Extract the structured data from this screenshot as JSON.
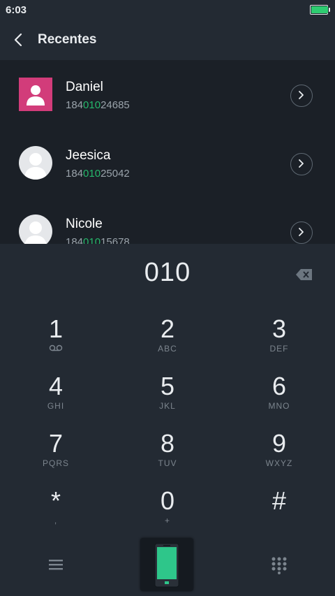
{
  "status": {
    "time": "6:03",
    "battery_level": 1.0,
    "battery_color": "#2ecc71"
  },
  "header": {
    "title": "Recentes"
  },
  "contacts": [
    {
      "name": "Daniel",
      "num_pre": "184",
      "num_match": "010",
      "num_post": "24685",
      "avatar": "photo-icon"
    },
    {
      "name": "Jeesica",
      "num_pre": "184",
      "num_match": "010",
      "num_post": "25042",
      "avatar": "person-icon"
    },
    {
      "name": "Nicole",
      "num_pre": "184",
      "num_match": "010",
      "num_post": "15678",
      "avatar": "person-icon"
    }
  ],
  "dialer": {
    "input": "010",
    "keys": [
      {
        "digit": "1",
        "letters": ""
      },
      {
        "digit": "2",
        "letters": "ABC"
      },
      {
        "digit": "3",
        "letters": "DEF"
      },
      {
        "digit": "4",
        "letters": "GHI"
      },
      {
        "digit": "5",
        "letters": "JKL"
      },
      {
        "digit": "6",
        "letters": "MNO"
      },
      {
        "digit": "7",
        "letters": "PQRS"
      },
      {
        "digit": "8",
        "letters": "TUV"
      },
      {
        "digit": "9",
        "letters": "WXYZ"
      },
      {
        "digit": "*",
        "letters": ","
      },
      {
        "digit": "0",
        "letters": "+"
      },
      {
        "digit": "#",
        "letters": ""
      }
    ]
  },
  "colors": {
    "accent": "#25b86b",
    "background": "#1b2027",
    "panel": "#232a33"
  }
}
